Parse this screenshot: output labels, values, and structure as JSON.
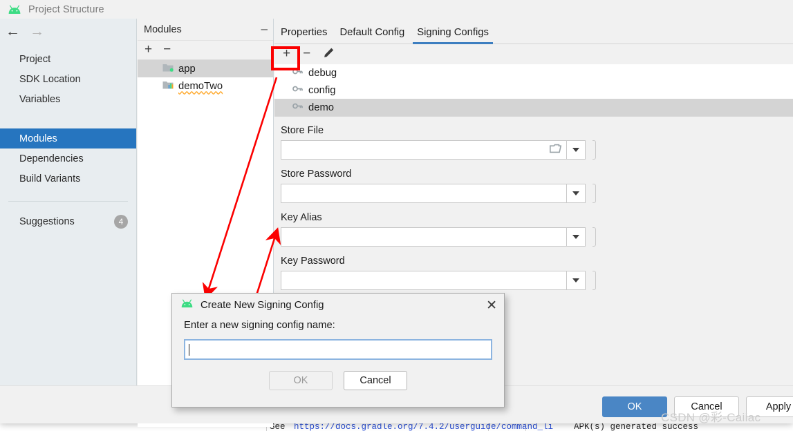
{
  "window": {
    "title": "Project Structure",
    "icon": "android-icon"
  },
  "nav": {
    "back_icon": "arrow-left-icon",
    "forward_icon": "arrow-right-icon",
    "items": [
      {
        "label": "Project",
        "selected": false
      },
      {
        "label": "SDK Location",
        "selected": false
      },
      {
        "label": "Variables",
        "selected": false
      },
      {
        "label": "Modules",
        "selected": true
      },
      {
        "label": "Dependencies",
        "selected": false
      },
      {
        "label": "Build Variants",
        "selected": false
      }
    ],
    "suggestions": {
      "label": "Suggestions",
      "count": "4"
    }
  },
  "modules_panel": {
    "title": "Modules",
    "minimize_glyph": "–",
    "add_glyph": "+",
    "remove_glyph": "−",
    "items": [
      {
        "label": "app",
        "icon": "module-app-icon",
        "selected": true,
        "wavy": false
      },
      {
        "label": "demoTwo",
        "icon": "module-library-icon",
        "selected": false,
        "wavy": true
      }
    ]
  },
  "tabs": [
    {
      "label": "Properties",
      "active": false
    },
    {
      "label": "Default Config",
      "active": false
    },
    {
      "label": "Signing Configs",
      "active": true
    }
  ],
  "config_toolbar": {
    "add_glyph": "+",
    "remove_glyph": "−",
    "edit_icon": "pencil-icon"
  },
  "signing_configs": [
    {
      "label": "debug",
      "selected": false
    },
    {
      "label": "config",
      "selected": false
    },
    {
      "label": "demo",
      "selected": true
    }
  ],
  "form": {
    "fields": [
      {
        "label": "Store File",
        "value": "",
        "has_folder_icon": true
      },
      {
        "label": "Store Password",
        "value": "",
        "has_folder_icon": false
      },
      {
        "label": "Key Alias",
        "value": "",
        "has_folder_icon": false
      },
      {
        "label": "Key Password",
        "value": "",
        "has_folder_icon": false
      }
    ]
  },
  "footer": {
    "ok": "OK",
    "cancel": "Cancel",
    "apply": "Apply"
  },
  "watermark": "CSDN @彩-Caiiac",
  "modal": {
    "icon": "android-icon",
    "title": "Create New Signing Config",
    "close_glyph": "✕",
    "prompt": "Enter a new signing config name:",
    "input_value": "",
    "ok": "OK",
    "cancel": "Cancel"
  },
  "background_strip": {
    "text_prefix": "See ",
    "link": "https://docs.gradle.org/7.4.2/userguide/command_li",
    "right_text": "APK(s) generated success"
  },
  "colors": {
    "accent_blue": "#2675bf",
    "tab_underline": "#3d7ec0",
    "primary_button": "#4a86c5",
    "annotation_red": "#fb0000",
    "selection_gray": "#d4d4d4",
    "android_green": "#3ddc84"
  }
}
